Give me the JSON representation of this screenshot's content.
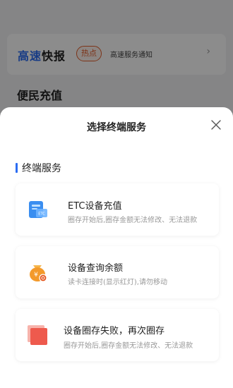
{
  "background": {
    "news": {
      "title_highlight": "高速",
      "title_rest": "快报",
      "badge": "热点",
      "text": "高速服务通知",
      "arrow": "›"
    },
    "section_title": "便民充值"
  },
  "sheet": {
    "title": "选择终端服务",
    "close_icon": "close-icon",
    "section_label": "终端服务",
    "items": [
      {
        "title": "ETC设备充值",
        "desc": "圈存开始后,圈存金额无法修改、无法退款",
        "icon": "etc-card-icon",
        "icon_text": "ETC"
      },
      {
        "title": "设备查询余额",
        "desc": "读卡连接时(显示红灯),请勿移动",
        "icon": "money-bag-icon",
        "icon_text": "¥"
      },
      {
        "title": "设备圈存失败，再次圈存",
        "desc": "圈存开始后,圈存金额无法修改、无法退款",
        "icon": "retry-square-icon"
      }
    ]
  },
  "colors": {
    "accent_blue": "#2b6cf2",
    "hot_orange": "#e25e2c",
    "retry_red": "#ee5a4d",
    "bag_orange": "#f39a2b"
  }
}
